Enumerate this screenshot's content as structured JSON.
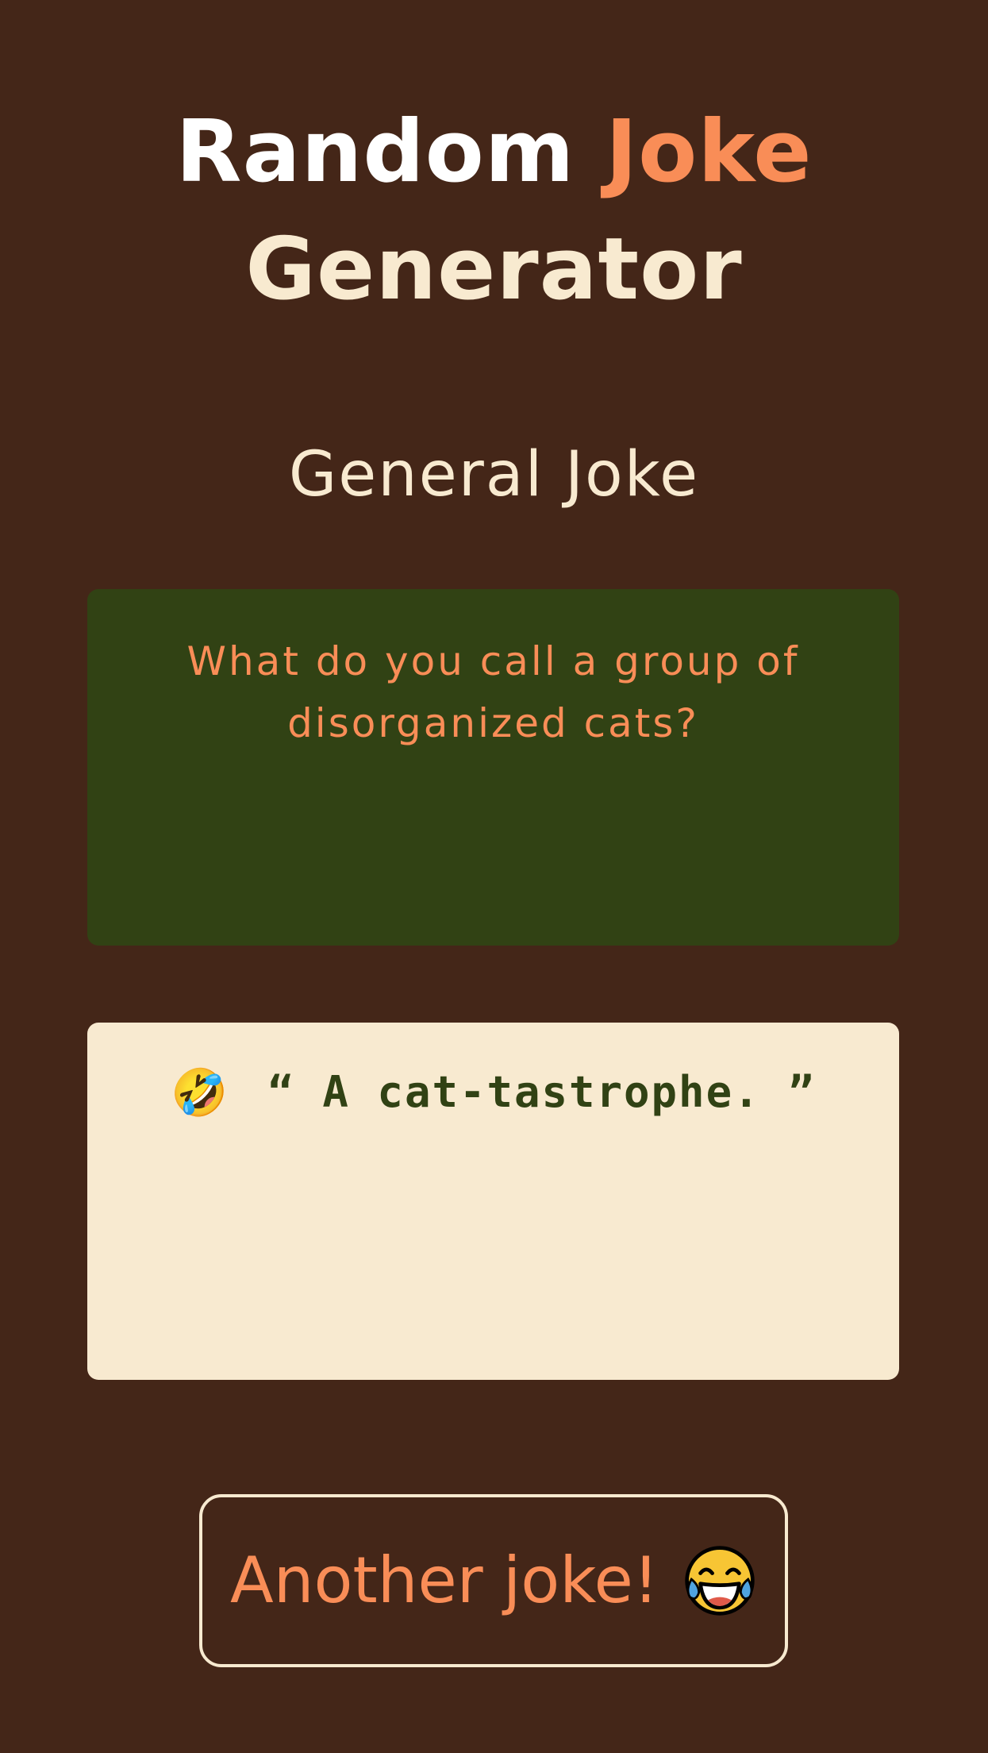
{
  "header": {
    "title_word1": "Random",
    "title_word2": "Joke",
    "title_word3": "Generator"
  },
  "joke": {
    "category": "General Joke",
    "setup": "What do you call a group of disorganized cats?",
    "punchline": "“ A cat-tastrophe. ”",
    "punchline_emoji": "🤣"
  },
  "button": {
    "label": "Another joke!",
    "icon": "face-with-tears-of-joy-icon"
  },
  "colors": {
    "background": "#442618",
    "accent": "#f98d57",
    "cream": "#f8ead0",
    "green": "#314214",
    "white": "#ffffff"
  }
}
